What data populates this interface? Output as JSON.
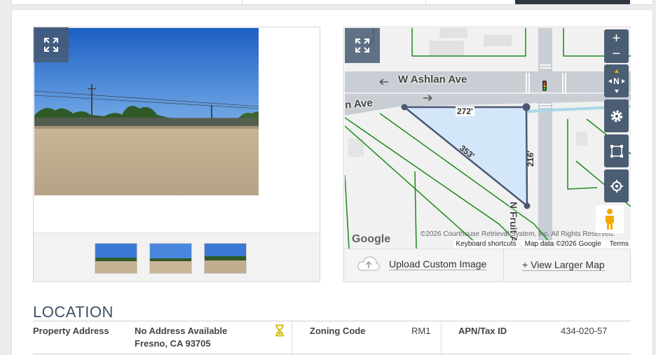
{
  "photos": {
    "thumbnail_count": 3
  },
  "map": {
    "street_1": "W Ashlan Ave",
    "street_2": "n Ave",
    "street_3": "N Fruit A",
    "dim_top": "272'",
    "dim_diag": "353'",
    "dim_right": "216'",
    "google": "Google",
    "copyright": "©2026 Courthouse Retrieval System, Inc. All Rights Reserved.",
    "keyboard_shortcuts": "Keyboard shortcuts",
    "map_data": "Map data ©2026 Google",
    "terms": "Terms",
    "controls": {
      "zoom_in": "+",
      "zoom_out": "−",
      "compass": "N"
    },
    "upload_label": "Upload Custom Image",
    "view_larger_label": "+ View Larger Map"
  },
  "location": {
    "title": "LOCATION",
    "property_address_label": "Property Address",
    "address_line1": "No Address Available",
    "address_line2": "Fresno, CA 93705",
    "zoning_label": "Zoning Code",
    "zoning_value": "RM1",
    "apn_label": "APN/Tax ID",
    "apn_value": "434-020-57"
  },
  "colors": {
    "accent": "#3d5068",
    "control_bg": "#4b5d73",
    "parcel_fill": "#d4e6f9",
    "hourglass": "#d4b800"
  }
}
